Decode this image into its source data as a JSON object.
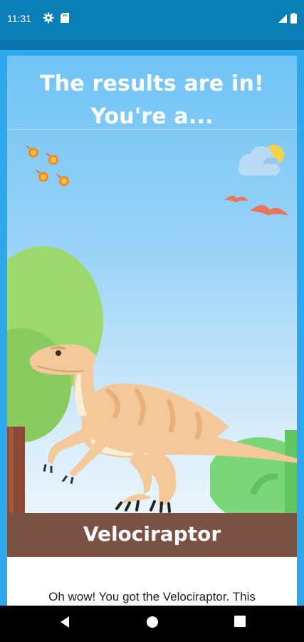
{
  "status_bar": {
    "time": "11:31",
    "left_icons": [
      "gear-icon",
      "sd-card-icon"
    ],
    "right_icons": [
      "signal-icon",
      "battery-icon"
    ]
  },
  "result": {
    "headline_line1": "The results are in!",
    "headline_line2": "You're a...",
    "dinosaur_name": "Velociraptor",
    "description": "Oh wow! You got the Velociraptor. This"
  },
  "colors": {
    "status_bar": "#0a7fb7",
    "frame": "#2ea7ec",
    "sky_top": "#6fc3f6",
    "name_bar": "#7a5143"
  },
  "nav_bar": {
    "buttons": [
      "back-icon",
      "home-icon",
      "recents-icon"
    ]
  }
}
